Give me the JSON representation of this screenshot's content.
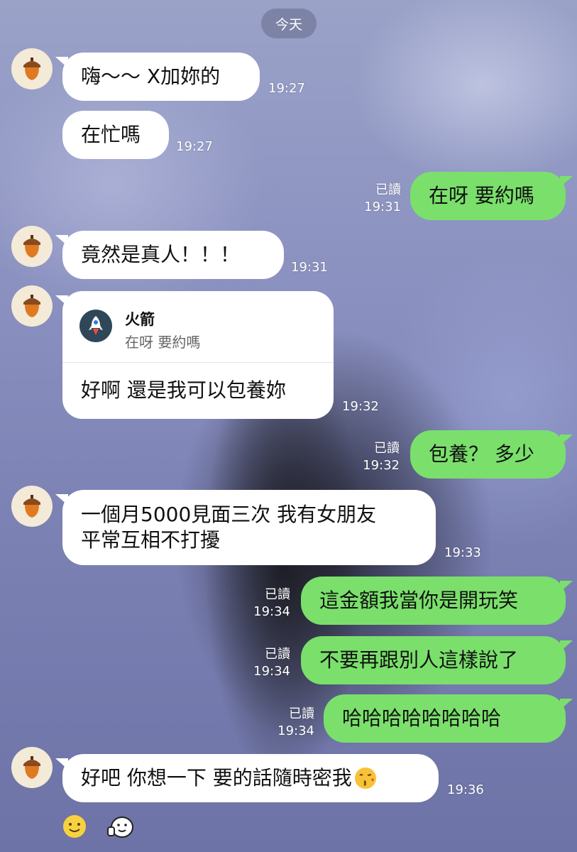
{
  "date_separator": "今天",
  "colors": {
    "incoming_bubble": "#ffffff",
    "outgoing_bubble": "#7ae06b",
    "avatar_background": "#f3ead8",
    "quote_icon_background": "#2f4758"
  },
  "contact_avatar_icon": "acorn-icon",
  "messages": [
    {
      "id": "m1",
      "from": "them",
      "text": "嗨～～ X加妳的",
      "time": "19:27"
    },
    {
      "id": "m2",
      "from": "them",
      "text": "在忙嗎",
      "time": "19:27"
    },
    {
      "id": "m3",
      "from": "me",
      "text": "在呀 要約嗎",
      "status": "已讀",
      "time": "19:31"
    },
    {
      "id": "m4",
      "from": "them",
      "text": "竟然是真人！！！",
      "time": "19:31"
    },
    {
      "id": "m5",
      "from": "them",
      "reply_to": {
        "name": "火箭",
        "text": "在呀 要約嗎",
        "icon": "rocket-icon"
      },
      "text": "好啊 還是我可以包養妳",
      "time": "19:32"
    },
    {
      "id": "m6",
      "from": "me",
      "text": "包養？ 多少",
      "status": "已讀",
      "time": "19:32"
    },
    {
      "id": "m7",
      "from": "them",
      "lines": [
        "一個月5000見面三次 我有女朋友",
        "平常互相不打擾"
      ],
      "time": "19:33"
    },
    {
      "id": "m8",
      "from": "me",
      "text": "這金額我當你是開玩笑",
      "status": "已讀",
      "time": "19:34"
    },
    {
      "id": "m9",
      "from": "me",
      "text": "不要再跟別人這樣說了",
      "status": "已讀",
      "time": "19:34"
    },
    {
      "id": "m10",
      "from": "me",
      "text": "哈哈哈哈哈哈哈哈",
      "status": "已讀",
      "time": "19:34"
    },
    {
      "id": "m11",
      "from": "them",
      "text": "好吧 你想一下 要的話隨時密我",
      "emoji": "kissing-face-emoji",
      "time": "19:36"
    }
  ],
  "bottom_bar": {
    "left_icon": "smiley-emoji-icon",
    "right_icon": "sticker-icon"
  }
}
